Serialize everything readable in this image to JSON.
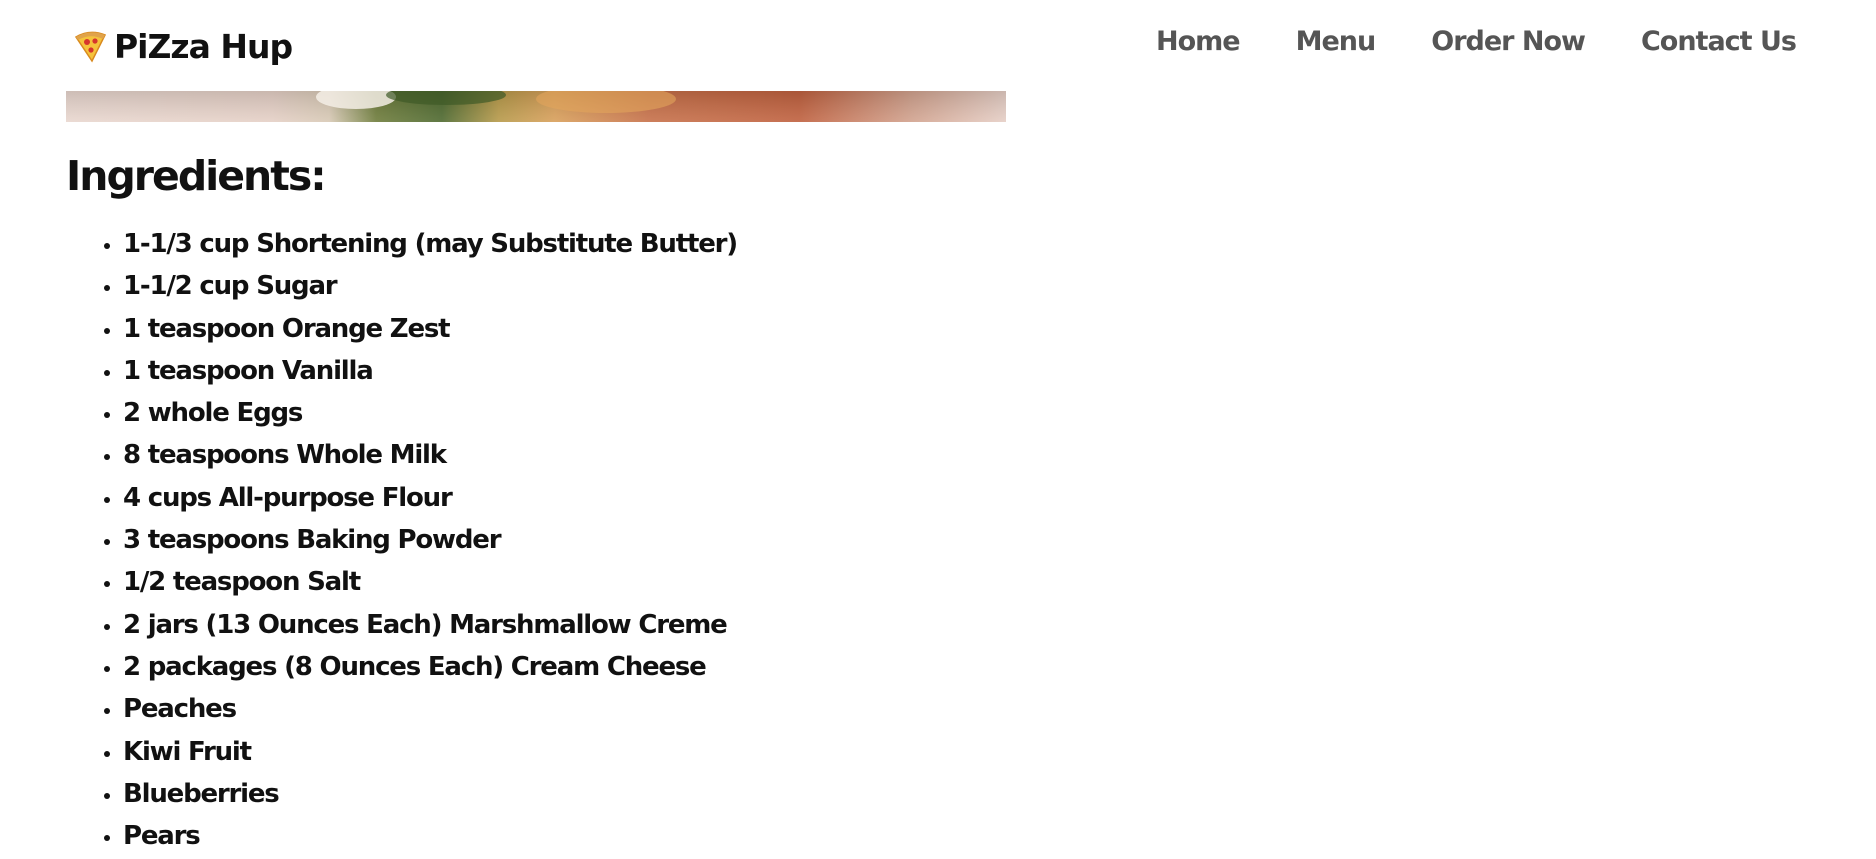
{
  "brand": {
    "icon": "pizza-slice-icon",
    "name": "PiZza Hup"
  },
  "nav": {
    "items": [
      {
        "label": "Home"
      },
      {
        "label": "Menu"
      },
      {
        "label": "Order Now"
      },
      {
        "label": "Contact Us"
      }
    ]
  },
  "ingredients": {
    "heading": "Ingredients:",
    "items": [
      "1-1/3 cup Shortening (may Substitute Butter)",
      "1-1/2 cup Sugar",
      "1 teaspoon Orange Zest",
      "1 teaspoon Vanilla",
      "2 whole Eggs",
      "8 teaspoons Whole Milk",
      "4 cups All-purpose Flour",
      "3 teaspoons Baking Powder",
      "1/2 teaspoon Salt",
      "2 jars (13 Ounces Each) Marshmallow Creme",
      "2 packages (8 Ounces Each) Cream Cheese",
      "Peaches",
      "Kiwi Fruit",
      "Blueberries",
      "Pears"
    ]
  },
  "colors": {
    "nav_text": "#555555",
    "heading_text": "#111111",
    "background": "#ffffff"
  }
}
